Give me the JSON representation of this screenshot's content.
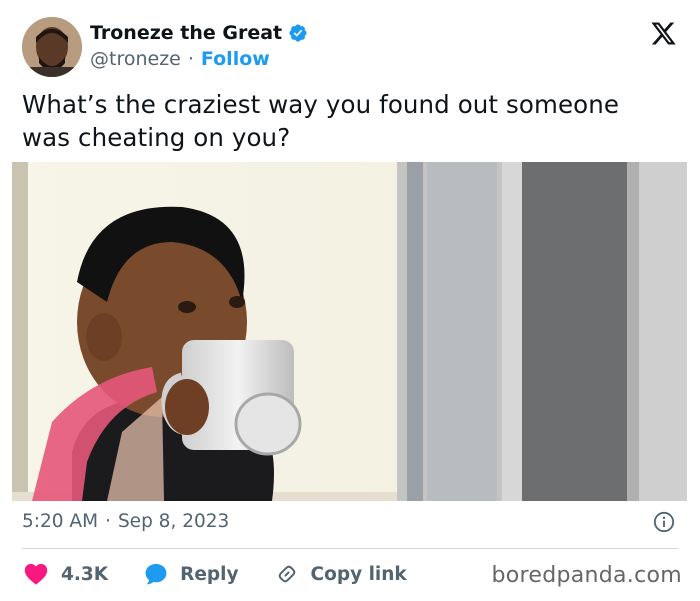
{
  "author": {
    "name": "Troneze the Great",
    "handle": "@troneze",
    "separator": "·",
    "follow_label": "Follow"
  },
  "tweet": {
    "text": "What’s the craziest way you found out someone was cheating on you?"
  },
  "meta": {
    "time": "5:20 AM",
    "separator": "·",
    "date": "Sep 8, 2023"
  },
  "actions": {
    "likes": "4.3K",
    "reply_label": "Reply",
    "copy_label": "Copy link"
  },
  "watermark": "boredpanda.com",
  "colors": {
    "accent": "#1d9bf0",
    "like": "#f91880",
    "text": "#0f1419",
    "muted": "#536471"
  },
  "icons": [
    "x-logo-icon",
    "verified-badge-icon",
    "info-icon",
    "heart-icon",
    "reply-bubble-icon",
    "link-icon"
  ]
}
